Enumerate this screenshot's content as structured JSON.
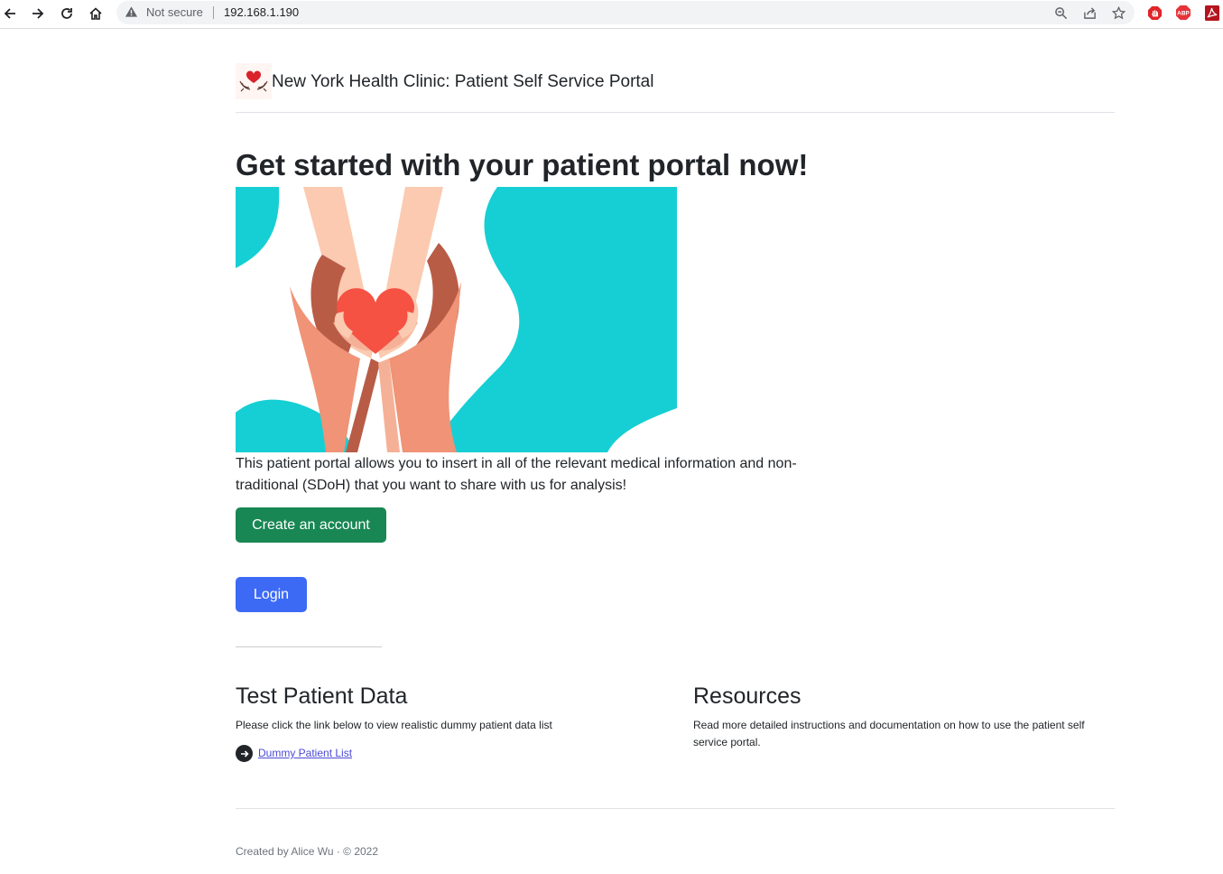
{
  "browser": {
    "security_label": "Not secure",
    "url": "192.168.1.190",
    "icons": [
      "back-arrow-icon",
      "forward-arrow-icon",
      "reload-icon",
      "home-icon",
      "warning-icon",
      "zoom-icon",
      "share-icon",
      "star-icon",
      "adblock-stop-icon",
      "abp-icon",
      "pdf-icon"
    ],
    "abp_label": "ABP"
  },
  "header": {
    "brand": "New York Health Clinic: Patient Self Service Portal",
    "logo_icon": "heart-hands-icon"
  },
  "hero": {
    "title": "Get started with your patient portal now!",
    "image_icon": "hands-holding-heart-illustration",
    "description": "This patient portal allows you to insert in all of the relevant medical information and non-traditional (SDoH) that you want to share with us for analysis!"
  },
  "actions": {
    "create_account": "Create an account",
    "login": "Login"
  },
  "test_patient": {
    "heading": "Test Patient Data",
    "text": "Please click the link below to view realistic dummy patient data list",
    "link": "Dummy Patient List"
  },
  "resources": {
    "heading": "Resources",
    "text": "Read more detailed instructions and documentation on how to use the patient self service portal."
  },
  "footer": {
    "text": "Created by Alice Wu · © 2022"
  },
  "colors": {
    "primary": "#3d6af5",
    "success": "#198754",
    "teal": "#15cfd4",
    "heart": "#f55243"
  }
}
